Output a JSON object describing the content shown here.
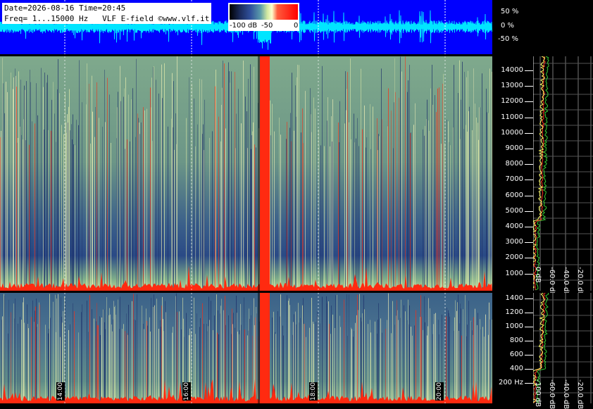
{
  "header": {
    "date_line": "Date=2026-08-16 Time=20:45",
    "freq_line": "Freq= 1...15000 Hz   VLF E-field ©www.vlf.it"
  },
  "colorbar": {
    "labels": [
      "-100 dB",
      "-50",
      "0"
    ]
  },
  "waveform_axis": {
    "labels": [
      "50 %",
      "0 %",
      "-50 %"
    ]
  },
  "freq_axis_upper": [
    "14000",
    "13000",
    "12000",
    "11000",
    "10000",
    "9000",
    "8000",
    "7000",
    "6000",
    "5000",
    "4000",
    "3000",
    "2000",
    "1000"
  ],
  "freq_axis_lower": [
    "1400",
    "1200",
    "1000",
    "800",
    "600",
    "400",
    "200 Hz"
  ],
  "profile_db_labels_upper": [
    "0 dB",
    "-60.0 dB",
    "-40.0 dB",
    "-20.0 dB"
  ],
  "profile_db_labels_lower": [
    "-100 dB",
    "-60.0 dB",
    "-40.0 dB",
    "-20.0 dB"
  ],
  "time_labels": [
    "14:00",
    "16:00",
    "18:00",
    "20:00"
  ],
  "colors": {
    "wave_bg": "#0000ff",
    "wave_trace": "#00e5ff",
    "spec_hot": "#ff2a10",
    "profile_avg": "#ffff66",
    "profile_peak": "#33cc33",
    "profile_min": "#ff3322"
  }
}
